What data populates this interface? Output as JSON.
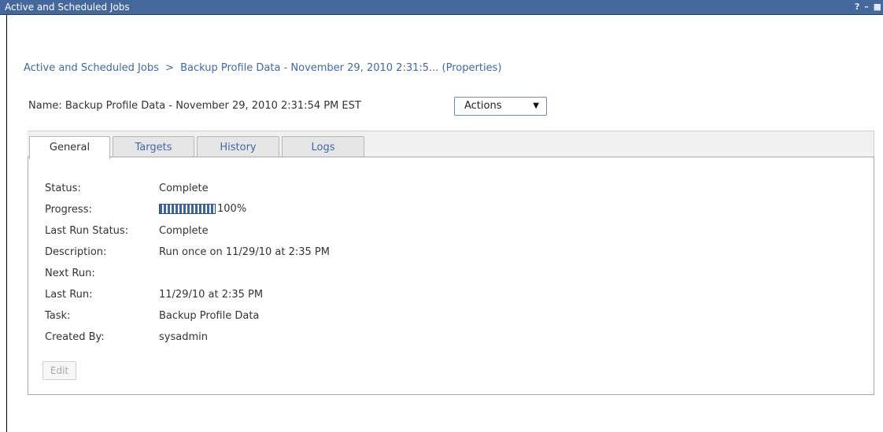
{
  "window": {
    "title": "Active and Scheduled Jobs",
    "controls": [
      "?",
      "–",
      "■"
    ]
  },
  "breadcrumb": {
    "root": "Active and Scheduled Jobs",
    "separator": ">",
    "current": "Backup Profile Data - November 29, 2010 2:31:5... (Properties)"
  },
  "job": {
    "name_label": "Name:",
    "name_value": "Backup Profile Data - November 29, 2010 2:31:54 PM EST",
    "actions_label": "Actions",
    "actions_icon": "chevron-down-icon"
  },
  "tabs": [
    {
      "label": "General",
      "active": true
    },
    {
      "label": "Targets",
      "active": false
    },
    {
      "label": "History",
      "active": false
    },
    {
      "label": "Logs",
      "active": false
    }
  ],
  "properties": {
    "status": {
      "label": "Status:",
      "value": "Complete"
    },
    "progress": {
      "label": "Progress:",
      "percent": 100,
      "text": "100%"
    },
    "last_run_status": {
      "label": "Last Run Status:",
      "value": "Complete"
    },
    "description": {
      "label": "Description:",
      "value": "Run once on 11/29/10 at 2:35 PM"
    },
    "next_run": {
      "label": "Next Run:",
      "value": ""
    },
    "last_run": {
      "label": "Last Run:",
      "value": "11/29/10 at 2:35 PM"
    },
    "task": {
      "label": "Task:",
      "value": "Backup Profile Data"
    },
    "created_by": {
      "label": "Created By:",
      "value": "sysadmin"
    }
  },
  "edit_button": {
    "label": "Edit",
    "enabled": false
  },
  "colors": {
    "titlebar": "#44689c",
    "link": "#3d6aa8",
    "progress": "#3b66a3"
  }
}
